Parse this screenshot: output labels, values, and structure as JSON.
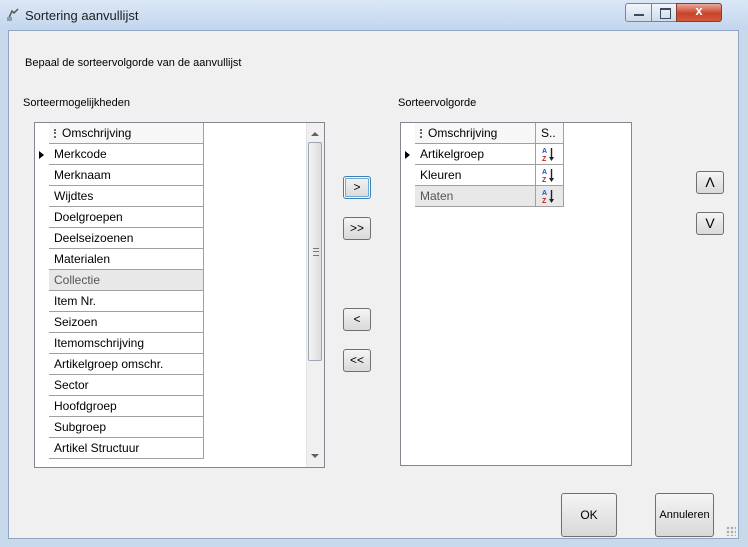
{
  "window": {
    "title": "Sortering aanvullijst",
    "close_glyph": "x"
  },
  "instruction": "Bepaal de sorteervolgorde van de aanvullijst",
  "available": {
    "label": "Sorteermogelijkheden",
    "column_header": "Omschrijving",
    "items": [
      "Merkcode",
      "Merknaam",
      "Wijdtes",
      "Doelgroepen",
      "Deelseizoenen",
      "Materialen",
      "Collectie",
      "Item Nr.",
      "Seizoen",
      "Itemomschrijving",
      "Artikelgroep omschr.",
      "Sector",
      "Hoofdgroep",
      "Subgroep",
      "Artikel Structuur"
    ],
    "current_index": 0,
    "selected_index": 6
  },
  "sort_order": {
    "label": "Sorteervolgorde",
    "column_headers": [
      "Omschrijving",
      "S.."
    ],
    "items": [
      {
        "name": "Artikelgroep",
        "direction_icon": "sort-ascending-icon"
      },
      {
        "name": "Kleuren",
        "direction_icon": "sort-ascending-icon"
      },
      {
        "name": "Maten",
        "direction_icon": "sort-ascending-icon"
      }
    ],
    "current_index": 0,
    "selected_index": 2
  },
  "buttons": {
    "add_one": ">",
    "add_all": ">>",
    "remove_one": "<",
    "remove_all": "<<",
    "move_up": "Λ",
    "move_down": "V",
    "ok": "OK",
    "cancel": "Annuleren"
  },
  "colors": {
    "sort_icon_a": "#1f4fd1",
    "sort_icon_z": "#c81e1e",
    "selected_row": "#e8e8e8"
  }
}
